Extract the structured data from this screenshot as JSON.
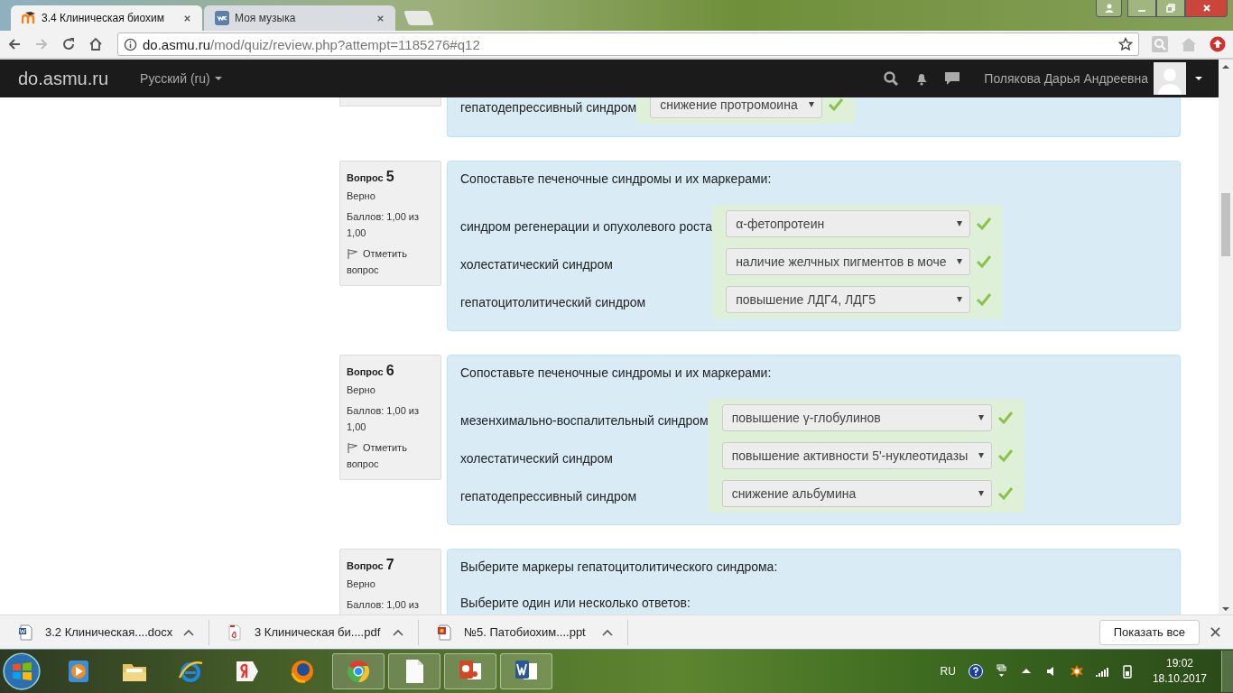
{
  "browser": {
    "tabs": [
      {
        "title": "3.4 Клиническая биохим",
        "selected": true
      },
      {
        "title": "Моя музыка",
        "selected": false
      }
    ],
    "url_host": "do.asmu.ru",
    "url_path": "/mod/quiz/review.php?attempt=1185276#q12"
  },
  "navbar": {
    "brand": "do.asmu.ru",
    "language": "Русский (ru)",
    "user": "Полякова Дарья Андреевна"
  },
  "questions": [
    {
      "partial": true,
      "rows": [
        {
          "label": "гепатодепрессивный синдром",
          "answer": "снижение протромоина",
          "correct": true
        }
      ]
    },
    {
      "partial": false,
      "label": "Вопрос",
      "number": "5",
      "status": "Верно",
      "score": "Баллов: 1,00 из 1,00",
      "flag": "Отметить вопрос",
      "prompt": "Сопоставьте печеночные синдромы и их маркерами:",
      "rows": [
        {
          "label": "синдром регенерации и опухолевого роста",
          "answer": "α-фетопротеин",
          "correct": true
        },
        {
          "label": "холестатический синдром",
          "answer": "наличие желчных пигментов в моче",
          "correct": true
        },
        {
          "label": "гепатоцитолитический синдром",
          "answer": "повышение ЛДГ4, ЛДГ5",
          "correct": true
        }
      ]
    },
    {
      "partial": false,
      "label": "Вопрос",
      "number": "6",
      "status": "Верно",
      "score": "Баллов: 1,00 из 1,00",
      "flag": "Отметить вопрос",
      "prompt": "Сопоставьте печеночные синдромы и их маркерами:",
      "rows": [
        {
          "label": "мезенхимально-воспалительный синдром",
          "answer": "повышение γ-глобулинов",
          "correct": true
        },
        {
          "label": "холестатический синдром",
          "answer": "повышение активности 5'-нуклеотидазы",
          "correct": true
        },
        {
          "label": "гепатодепрессивный синдром",
          "answer": "снижение альбумина",
          "correct": true
        }
      ]
    },
    {
      "partial": false,
      "label": "Вопрос",
      "number": "7",
      "status": "Верно",
      "score": "Баллов: 1,00 из",
      "prompt": "Выберите маркеры гепатоцитолитического синдрома:",
      "instruction": "Выберите один или несколько ответов:"
    }
  ],
  "downloads": [
    {
      "name": "3.2 Клиническая....docx",
      "kind": "word"
    },
    {
      "name": "3 Клиническая би....pdf",
      "kind": "pdf"
    },
    {
      "name": "№5. Патобиохим....ppt",
      "kind": "ppt"
    }
  ],
  "show_all": "Показать все",
  "taskbar": [
    {
      "kind": "player",
      "running": false
    },
    {
      "kind": "folder",
      "running": false
    },
    {
      "kind": "ie",
      "running": false
    },
    {
      "kind": "yandex",
      "running": false
    },
    {
      "kind": "firefox",
      "running": false
    },
    {
      "kind": "chrome",
      "running": true
    },
    {
      "kind": "doc",
      "running": true
    },
    {
      "kind": "powerpoint",
      "running": true
    },
    {
      "kind": "word",
      "running": true
    }
  ],
  "tray": {
    "language": "RU",
    "time": "19:02",
    "date": "18.10.2017"
  }
}
